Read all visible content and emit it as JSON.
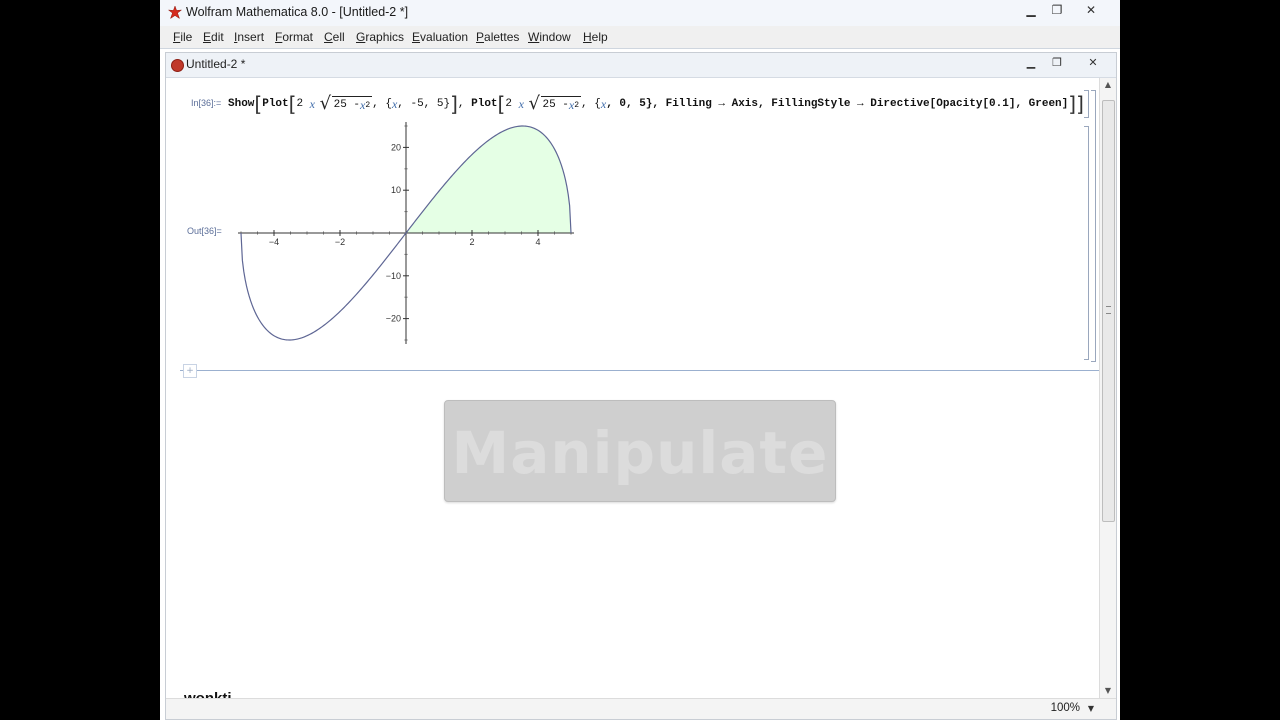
{
  "window": {
    "title": "Wolfram Mathematica 8.0 - [Untitled-2 *]",
    "icons": {
      "app": "mathematica-star-icon",
      "minimize": "minimize-icon",
      "maximize": "restore-icon",
      "close": "close-icon"
    }
  },
  "menu": {
    "items": [
      "File",
      "Edit",
      "Insert",
      "Format",
      "Cell",
      "Graphics",
      "Evaluation",
      "Palettes",
      "Window",
      "Help"
    ]
  },
  "document": {
    "title": "Untitled-2 *",
    "icon": "notebook-icon"
  },
  "notebook": {
    "in_label": "In[36]:=",
    "out_label": "Out[36]=",
    "input": {
      "t_show": "Show",
      "t_plot1": "Plot",
      "t_coef1": "2",
      "t_var1": "x",
      "t_sqrt1": "25 - ",
      "t_var1b": "x",
      "t_sup1": "2",
      "t_range1_open": ", {",
      "t_range1_var": "x",
      "t_range1_rest": ", -5, 5}",
      "t_sep": ",",
      "t_plot2": "Plot",
      "t_coef2": "2",
      "t_var2": "x",
      "t_sqrt2": "25 - ",
      "t_var2b": "x",
      "t_sup2": "2",
      "t_range2_open": ", {",
      "t_range2_var": "x",
      "t_range2_rest": ", 0, 5}, Filling → Axis, FillingStyle → Directive[Opacity[0.1], Green]"
    }
  },
  "overlay": {
    "text": "Manipulate"
  },
  "watermark": {
    "text": "wonkti"
  },
  "status": {
    "zoom": "100%"
  },
  "chart_data": {
    "type": "line",
    "function": "2 x sqrt(25 - x^2)",
    "xlim": [
      -5,
      5
    ],
    "ylim": [
      -25,
      25
    ],
    "x_ticks": [
      -4,
      -2,
      2,
      4
    ],
    "y_ticks": [
      -20,
      -10,
      10,
      20
    ],
    "x_tick_labels": [
      "-4",
      "-2",
      "2",
      "4"
    ],
    "y_tick_labels": [
      "-20",
      "-10",
      "10",
      "20"
    ],
    "fill": {
      "from": 0,
      "to": 5,
      "to_axis": true,
      "color": "#00ff00",
      "opacity": 0.1
    },
    "line_color": "#5e6694",
    "series": [
      {
        "x": [
          -5,
          -4.5,
          -4,
          -3.54,
          -3,
          -2,
          -1,
          0,
          1,
          2,
          3,
          3.54,
          4,
          4.5,
          5
        ],
        "y": [
          0,
          -19.6,
          -24,
          -25,
          -24,
          -18.3,
          -9.8,
          0,
          9.8,
          18.3,
          24,
          25,
          24,
          19.6,
          0
        ]
      }
    ]
  }
}
